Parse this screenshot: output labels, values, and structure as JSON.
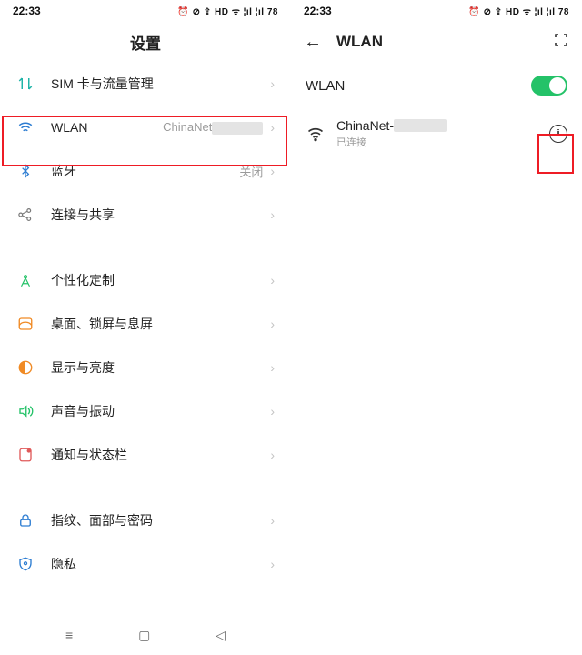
{
  "statusBar": {
    "time": "22:33",
    "indicators": "⏰ ⊘ ⇪ HD ᯤ ¦ıl ¦ıl 78"
  },
  "settings": {
    "title": "设置",
    "items": [
      {
        "label": "SIM 卡与流量管理",
        "value": ""
      },
      {
        "label": "WLAN",
        "value": "ChinaNet"
      },
      {
        "label": "蓝牙",
        "value": "关闭"
      },
      {
        "label": "连接与共享",
        "value": ""
      },
      {
        "label": "个性化定制",
        "value": ""
      },
      {
        "label": "桌面、锁屏与息屏",
        "value": ""
      },
      {
        "label": "显示与亮度",
        "value": ""
      },
      {
        "label": "声音与振动",
        "value": ""
      },
      {
        "label": "通知与状态栏",
        "value": ""
      },
      {
        "label": "指纹、面部与密码",
        "value": ""
      },
      {
        "label": "隐私",
        "value": ""
      }
    ]
  },
  "wlan": {
    "title": "WLAN",
    "toggleLabel": "WLAN",
    "toggleOn": true,
    "network": {
      "name": "ChinaNet-",
      "status": "已连接"
    }
  },
  "colors": {
    "accent": "#24c268",
    "highlight": "#ee1c25",
    "iconBlue": "#2d7dd2",
    "iconOrange": "#f08a24",
    "iconGreen": "#24c268",
    "iconTeal": "#1fb4a8",
    "iconGrey": "#7a7a7a"
  }
}
